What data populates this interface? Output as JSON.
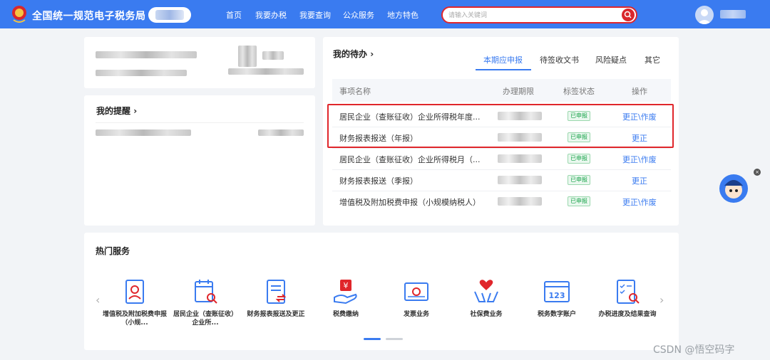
{
  "header": {
    "title": "全国统一规范电子税务局",
    "nav": [
      "首页",
      "我要办税",
      "我要查询",
      "公众服务",
      "地方特色"
    ],
    "search_placeholder": "请输入关键词"
  },
  "reminders": {
    "title": "我的提醒",
    "chevron": "›"
  },
  "todo": {
    "title": "我的待办",
    "chevron": "›",
    "tabs": [
      "本期应申报",
      "待签收文书",
      "风险疑点",
      "其它"
    ],
    "active_tab": "本期应申报",
    "columns": [
      "事项名称",
      "办理期限",
      "标签状态",
      "操作"
    ],
    "rows": [
      {
        "name": "居民企业（查账征收）企业所得税年度...",
        "status": "已申报",
        "action": "更正\\作废"
      },
      {
        "name": "财务报表报送（年报）",
        "status": "已申报",
        "action": "更正"
      },
      {
        "name": "居民企业（查账征收）企业所得税月（...",
        "status": "已申报",
        "action": "更正\\作废"
      },
      {
        "name": "财务报表报送（季报）",
        "status": "已申报",
        "action": "更正"
      },
      {
        "name": "增值税及附加税费申报（小规模纳税人）",
        "status": "已申报",
        "action": "更正\\作废"
      }
    ]
  },
  "hot_services": {
    "title": "热门服务",
    "items": [
      {
        "label": "增值税及附加税费申报（小规...",
        "icon": "tax-declaration-icon"
      },
      {
        "label": "居民企业（查账征收）企业所...",
        "icon": "calendar-search-icon"
      },
      {
        "label": "财务报表报送及更正",
        "icon": "report-exchange-icon"
      },
      {
        "label": "税费缴纳",
        "icon": "tax-payment-icon"
      },
      {
        "label": "发票业务",
        "icon": "invoice-icon"
      },
      {
        "label": "社保费业务",
        "icon": "social-security-icon"
      },
      {
        "label": "税务数字账户",
        "icon": "digital-account-icon"
      },
      {
        "label": "办税进度及结果查询",
        "icon": "progress-query-icon"
      }
    ],
    "prev": "‹",
    "next": "›"
  },
  "watermark": "CSDN @悟空码字",
  "float_close": "×",
  "colors": {
    "primary": "#3a7bf0",
    "danger": "#e0262b",
    "success": "#19a34a"
  }
}
